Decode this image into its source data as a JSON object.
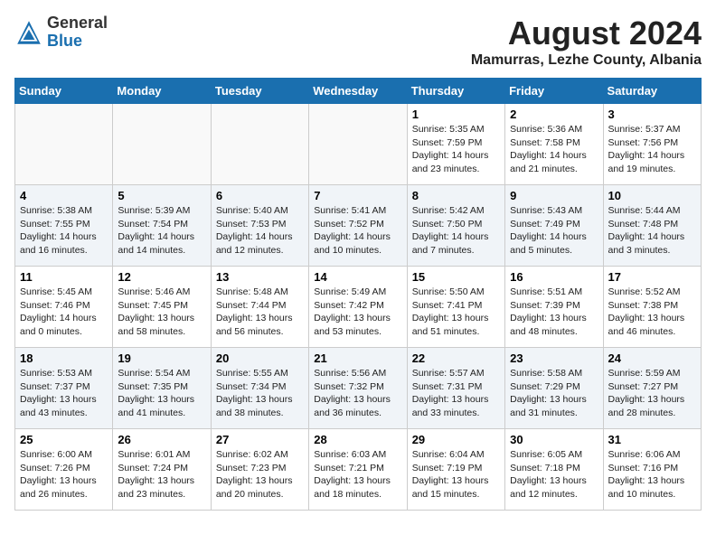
{
  "logo": {
    "general": "General",
    "blue": "Blue"
  },
  "title": "August 2024",
  "location": "Mamurras, Lezhe County, Albania",
  "days_header": [
    "Sunday",
    "Monday",
    "Tuesday",
    "Wednesday",
    "Thursday",
    "Friday",
    "Saturday"
  ],
  "weeks": [
    [
      {
        "day": "",
        "detail": ""
      },
      {
        "day": "",
        "detail": ""
      },
      {
        "day": "",
        "detail": ""
      },
      {
        "day": "",
        "detail": ""
      },
      {
        "day": "1",
        "detail": "Sunrise: 5:35 AM\nSunset: 7:59 PM\nDaylight: 14 hours\nand 23 minutes."
      },
      {
        "day": "2",
        "detail": "Sunrise: 5:36 AM\nSunset: 7:58 PM\nDaylight: 14 hours\nand 21 minutes."
      },
      {
        "day": "3",
        "detail": "Sunrise: 5:37 AM\nSunset: 7:56 PM\nDaylight: 14 hours\nand 19 minutes."
      }
    ],
    [
      {
        "day": "4",
        "detail": "Sunrise: 5:38 AM\nSunset: 7:55 PM\nDaylight: 14 hours\nand 16 minutes."
      },
      {
        "day": "5",
        "detail": "Sunrise: 5:39 AM\nSunset: 7:54 PM\nDaylight: 14 hours\nand 14 minutes."
      },
      {
        "day": "6",
        "detail": "Sunrise: 5:40 AM\nSunset: 7:53 PM\nDaylight: 14 hours\nand 12 minutes."
      },
      {
        "day": "7",
        "detail": "Sunrise: 5:41 AM\nSunset: 7:52 PM\nDaylight: 14 hours\nand 10 minutes."
      },
      {
        "day": "8",
        "detail": "Sunrise: 5:42 AM\nSunset: 7:50 PM\nDaylight: 14 hours\nand 7 minutes."
      },
      {
        "day": "9",
        "detail": "Sunrise: 5:43 AM\nSunset: 7:49 PM\nDaylight: 14 hours\nand 5 minutes."
      },
      {
        "day": "10",
        "detail": "Sunrise: 5:44 AM\nSunset: 7:48 PM\nDaylight: 14 hours\nand 3 minutes."
      }
    ],
    [
      {
        "day": "11",
        "detail": "Sunrise: 5:45 AM\nSunset: 7:46 PM\nDaylight: 14 hours\nand 0 minutes."
      },
      {
        "day": "12",
        "detail": "Sunrise: 5:46 AM\nSunset: 7:45 PM\nDaylight: 13 hours\nand 58 minutes."
      },
      {
        "day": "13",
        "detail": "Sunrise: 5:48 AM\nSunset: 7:44 PM\nDaylight: 13 hours\nand 56 minutes."
      },
      {
        "day": "14",
        "detail": "Sunrise: 5:49 AM\nSunset: 7:42 PM\nDaylight: 13 hours\nand 53 minutes."
      },
      {
        "day": "15",
        "detail": "Sunrise: 5:50 AM\nSunset: 7:41 PM\nDaylight: 13 hours\nand 51 minutes."
      },
      {
        "day": "16",
        "detail": "Sunrise: 5:51 AM\nSunset: 7:39 PM\nDaylight: 13 hours\nand 48 minutes."
      },
      {
        "day": "17",
        "detail": "Sunrise: 5:52 AM\nSunset: 7:38 PM\nDaylight: 13 hours\nand 46 minutes."
      }
    ],
    [
      {
        "day": "18",
        "detail": "Sunrise: 5:53 AM\nSunset: 7:37 PM\nDaylight: 13 hours\nand 43 minutes."
      },
      {
        "day": "19",
        "detail": "Sunrise: 5:54 AM\nSunset: 7:35 PM\nDaylight: 13 hours\nand 41 minutes."
      },
      {
        "day": "20",
        "detail": "Sunrise: 5:55 AM\nSunset: 7:34 PM\nDaylight: 13 hours\nand 38 minutes."
      },
      {
        "day": "21",
        "detail": "Sunrise: 5:56 AM\nSunset: 7:32 PM\nDaylight: 13 hours\nand 36 minutes."
      },
      {
        "day": "22",
        "detail": "Sunrise: 5:57 AM\nSunset: 7:31 PM\nDaylight: 13 hours\nand 33 minutes."
      },
      {
        "day": "23",
        "detail": "Sunrise: 5:58 AM\nSunset: 7:29 PM\nDaylight: 13 hours\nand 31 minutes."
      },
      {
        "day": "24",
        "detail": "Sunrise: 5:59 AM\nSunset: 7:27 PM\nDaylight: 13 hours\nand 28 minutes."
      }
    ],
    [
      {
        "day": "25",
        "detail": "Sunrise: 6:00 AM\nSunset: 7:26 PM\nDaylight: 13 hours\nand 26 minutes."
      },
      {
        "day": "26",
        "detail": "Sunrise: 6:01 AM\nSunset: 7:24 PM\nDaylight: 13 hours\nand 23 minutes."
      },
      {
        "day": "27",
        "detail": "Sunrise: 6:02 AM\nSunset: 7:23 PM\nDaylight: 13 hours\nand 20 minutes."
      },
      {
        "day": "28",
        "detail": "Sunrise: 6:03 AM\nSunset: 7:21 PM\nDaylight: 13 hours\nand 18 minutes."
      },
      {
        "day": "29",
        "detail": "Sunrise: 6:04 AM\nSunset: 7:19 PM\nDaylight: 13 hours\nand 15 minutes."
      },
      {
        "day": "30",
        "detail": "Sunrise: 6:05 AM\nSunset: 7:18 PM\nDaylight: 13 hours\nand 12 minutes."
      },
      {
        "day": "31",
        "detail": "Sunrise: 6:06 AM\nSunset: 7:16 PM\nDaylight: 13 hours\nand 10 minutes."
      }
    ]
  ]
}
